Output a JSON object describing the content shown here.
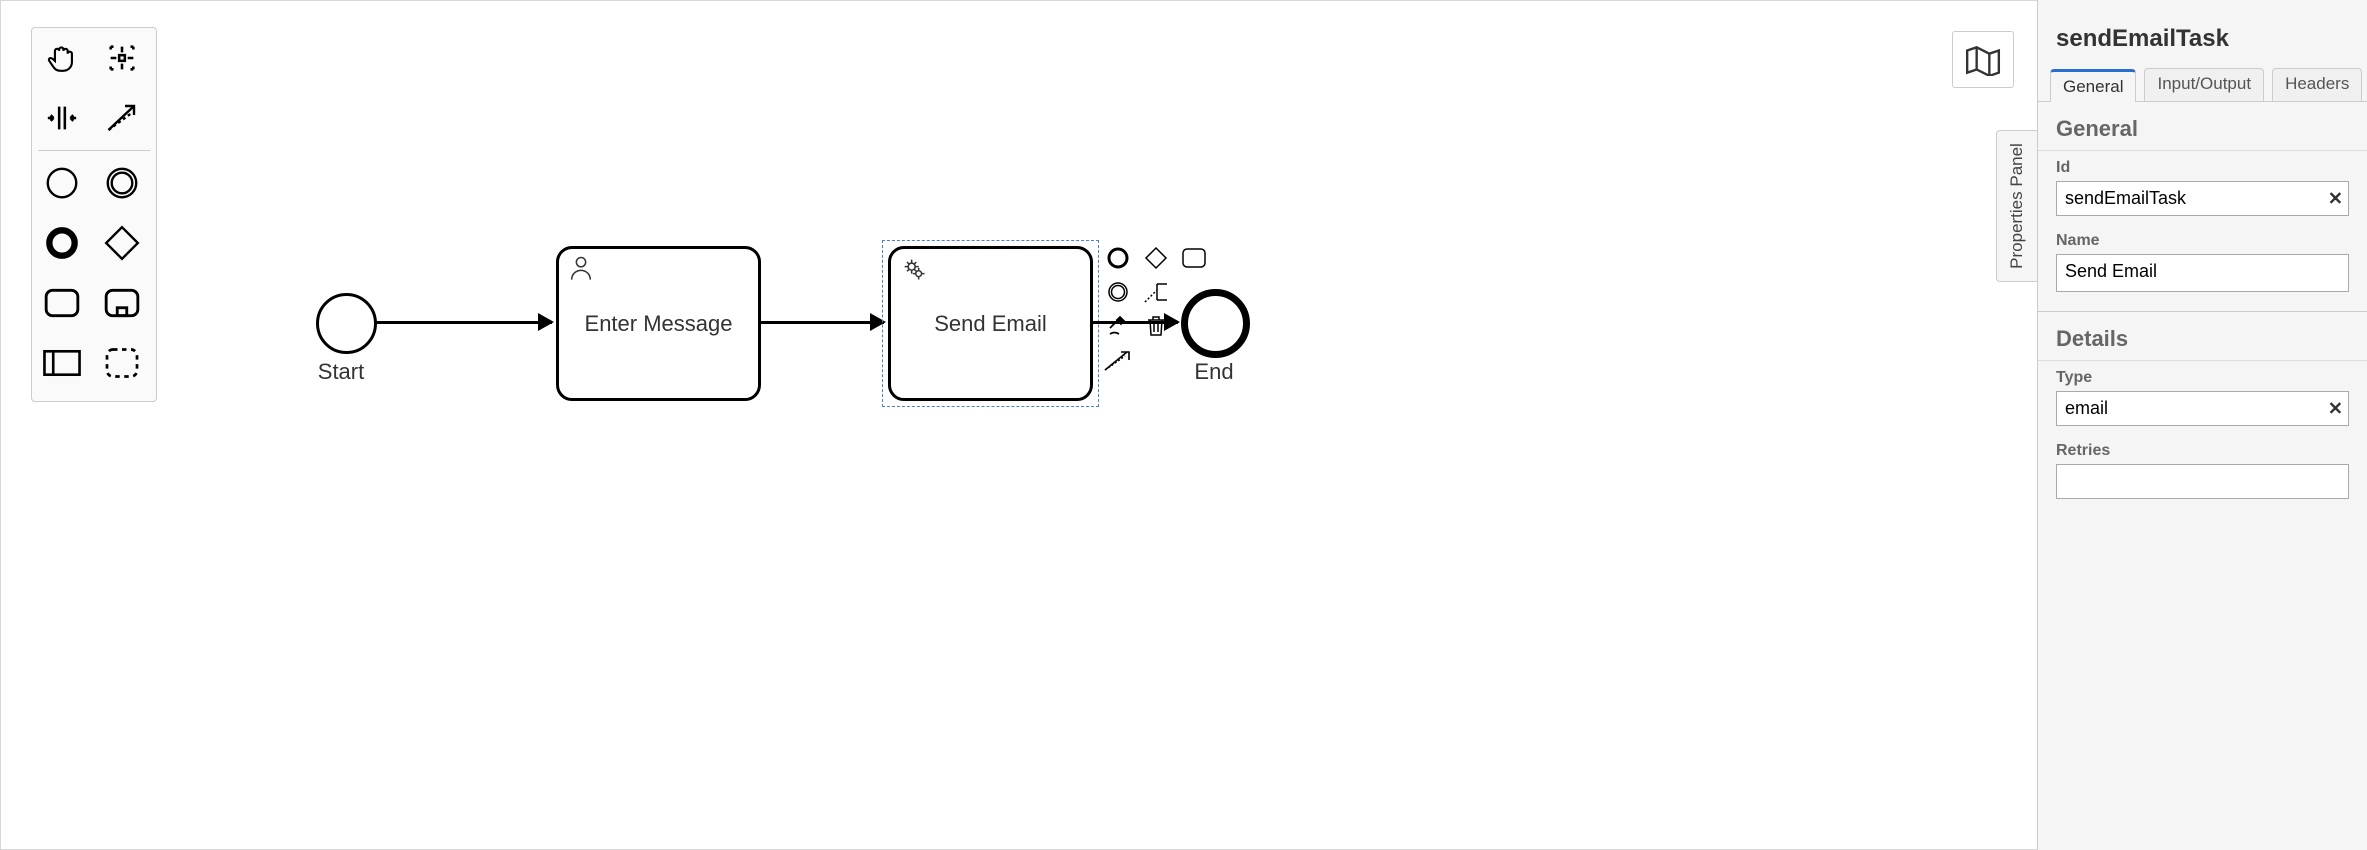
{
  "process": {
    "startLabel": "Start",
    "endLabel": "End",
    "task1": {
      "label": "Enter Message",
      "type": "userTask"
    },
    "task2": {
      "label": "Send Email",
      "type": "serviceTask"
    }
  },
  "palette": {
    "tools": {
      "hand": "hand-tool",
      "lasso": "lasso-tool",
      "space": "space-tool",
      "connect": "global-connect"
    },
    "elements": {
      "startEvent": "start-event",
      "intermediateEvent": "intermediate-event",
      "endEvent": "end-event",
      "gateway": "exclusive-gateway",
      "task": "task",
      "subprocessExpanded": "expanded-subprocess",
      "participant": "participant",
      "group": "group"
    }
  },
  "contextPad": {
    "appendEndEvent": "end-event",
    "appendGateway": "gateway",
    "appendTask": "task",
    "appendIntermediate": "intermediate-event",
    "annotate": "text-annotation",
    "changeType": "change-type",
    "delete": "delete",
    "connect": "connect"
  },
  "minimapLabel": "minimap",
  "propertiesPanel": {
    "toggleLabel": "Properties Panel",
    "title": "sendEmailTask",
    "tabs": {
      "general": "General",
      "io": "Input/Output",
      "headers": "Headers"
    },
    "activeTab": "general",
    "sections": {
      "general": {
        "header": "General",
        "id": {
          "label": "Id",
          "value": "sendEmailTask"
        },
        "name": {
          "label": "Name",
          "value": "Send Email"
        }
      },
      "details": {
        "header": "Details",
        "type": {
          "label": "Type",
          "value": "email"
        },
        "retries": {
          "label": "Retries",
          "value": ""
        }
      }
    }
  }
}
